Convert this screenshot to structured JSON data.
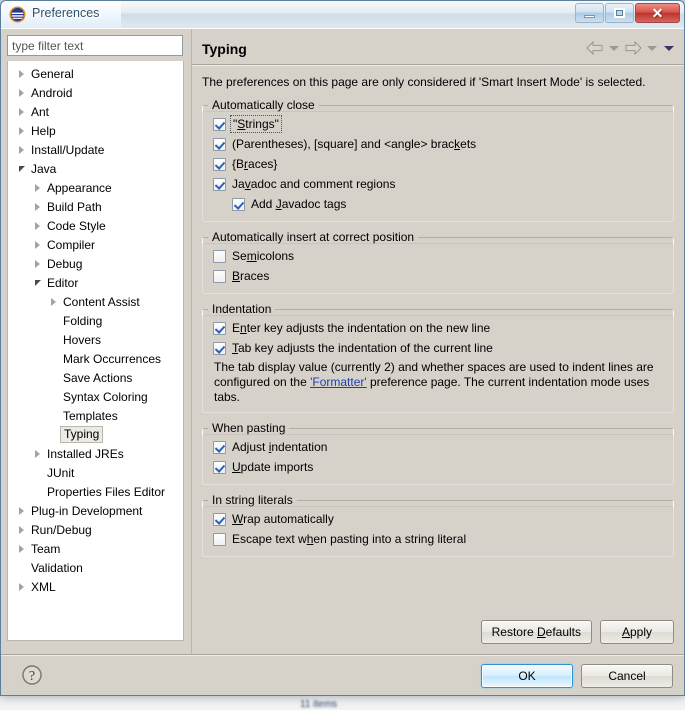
{
  "window": {
    "title": "Preferences",
    "icon": "eclipse-icon",
    "controls": {
      "minimize": "minimize-icon",
      "restore": "restore-icon",
      "close": "close-icon"
    }
  },
  "sidebar": {
    "filter": {
      "placeholder": "type filter text",
      "value": ""
    },
    "items": [
      {
        "label": "General",
        "depth": 0,
        "state": "collapsed"
      },
      {
        "label": "Android",
        "depth": 0,
        "state": "collapsed"
      },
      {
        "label": "Ant",
        "depth": 0,
        "state": "collapsed"
      },
      {
        "label": "Help",
        "depth": 0,
        "state": "collapsed"
      },
      {
        "label": "Install/Update",
        "depth": 0,
        "state": "collapsed"
      },
      {
        "label": "Java",
        "depth": 0,
        "state": "expanded"
      },
      {
        "label": "Appearance",
        "depth": 1,
        "state": "collapsed"
      },
      {
        "label": "Build Path",
        "depth": 1,
        "state": "collapsed"
      },
      {
        "label": "Code Style",
        "depth": 1,
        "state": "collapsed"
      },
      {
        "label": "Compiler",
        "depth": 1,
        "state": "collapsed"
      },
      {
        "label": "Debug",
        "depth": 1,
        "state": "collapsed"
      },
      {
        "label": "Editor",
        "depth": 1,
        "state": "expanded"
      },
      {
        "label": "Content Assist",
        "depth": 2,
        "state": "collapsed"
      },
      {
        "label": "Folding",
        "depth": 2,
        "state": "leaf"
      },
      {
        "label": "Hovers",
        "depth": 2,
        "state": "leaf"
      },
      {
        "label": "Mark Occurrences",
        "depth": 2,
        "state": "leaf"
      },
      {
        "label": "Save Actions",
        "depth": 2,
        "state": "leaf"
      },
      {
        "label": "Syntax Coloring",
        "depth": 2,
        "state": "leaf"
      },
      {
        "label": "Templates",
        "depth": 2,
        "state": "leaf"
      },
      {
        "label": "Typing",
        "depth": 2,
        "state": "leaf",
        "selected": true
      },
      {
        "label": "Installed JREs",
        "depth": 1,
        "state": "collapsed"
      },
      {
        "label": "JUnit",
        "depth": 1,
        "state": "leaf"
      },
      {
        "label": "Properties Files Editor",
        "depth": 1,
        "state": "leaf"
      },
      {
        "label": "Plug-in Development",
        "depth": 0,
        "state": "collapsed"
      },
      {
        "label": "Run/Debug",
        "depth": 0,
        "state": "collapsed"
      },
      {
        "label": "Team",
        "depth": 0,
        "state": "collapsed"
      },
      {
        "label": "Validation",
        "depth": 0,
        "state": "leaf"
      },
      {
        "label": "XML",
        "depth": 0,
        "state": "collapsed"
      }
    ]
  },
  "page": {
    "title": "Typing",
    "nav": {
      "back": "back-arrow-icon",
      "back_menu": "chevron-down-icon",
      "forward": "forward-arrow-icon",
      "forward_menu": "chevron-down-icon",
      "view_menu": "view-menu-icon"
    },
    "intro": "The preferences on this page are only considered if 'Smart Insert Mode' is selected.",
    "groups": [
      {
        "legend": "Automatically close",
        "options": [
          {
            "label": "\"Strings\"",
            "mnemonic": "S",
            "checked": true,
            "indent": false,
            "focused": true
          },
          {
            "label": "(Parentheses), [square] and <angle> brackets",
            "mnemonic": "k",
            "checked": true,
            "indent": false,
            "focused": false
          },
          {
            "label": "{Braces}",
            "mnemonic": "r",
            "checked": true,
            "indent": false,
            "focused": false
          },
          {
            "label": "Javadoc and comment regions",
            "mnemonic": "v",
            "checked": true,
            "indent": false,
            "focused": false
          },
          {
            "label": "Add Javadoc tags",
            "mnemonic": "J",
            "checked": true,
            "indent": true,
            "focused": false
          }
        ]
      },
      {
        "legend": "Automatically insert at correct position",
        "options": [
          {
            "label": "Semicolons",
            "mnemonic": "m",
            "checked": false,
            "indent": false,
            "focused": false
          },
          {
            "label": "Braces",
            "mnemonic": "B",
            "checked": false,
            "indent": false,
            "focused": false
          }
        ]
      },
      {
        "legend": "Indentation",
        "options": [
          {
            "label": "Enter key adjusts the indentation on the new line",
            "mnemonic": "n",
            "checked": true,
            "indent": false,
            "focused": false
          },
          {
            "label": "Tab key adjusts the indentation of the current line",
            "mnemonic": "T",
            "checked": true,
            "indent": false,
            "focused": false
          }
        ],
        "note": {
          "before": "The tab display value (currently 2) and whether spaces are used to indent lines are configured on the ",
          "link": "'Formatter'",
          "after": " preference page. The current indentation mode uses tabs."
        }
      },
      {
        "legend": "When pasting",
        "options": [
          {
            "label": "Adjust indentation",
            "mnemonic": "i",
            "checked": true,
            "indent": false,
            "focused": false
          },
          {
            "label": "Update imports",
            "mnemonic": "U",
            "checked": true,
            "indent": false,
            "focused": false
          }
        ]
      },
      {
        "legend": "In string literals",
        "options": [
          {
            "label": "Wrap automatically",
            "mnemonic": "W",
            "checked": true,
            "indent": false,
            "focused": false
          },
          {
            "label": "Escape text when pasting into a string literal",
            "mnemonic": "h",
            "checked": false,
            "indent": false,
            "focused": false
          }
        ]
      }
    ],
    "buttons": {
      "restore_defaults": "Restore Defaults",
      "restore_defaults_mnemonic": "D",
      "apply": "Apply",
      "apply_mnemonic": "A"
    }
  },
  "footer": {
    "help_icon": "help-icon",
    "ok": "OK",
    "cancel": "Cancel"
  },
  "colors": {
    "dialog_bg": "#d6d2ca",
    "tree_bg": "#ffffff",
    "link": "#1b3fb0",
    "check": "#2a62b8",
    "default_button_border": "#2c92d4",
    "close_button": "#bc352c"
  }
}
